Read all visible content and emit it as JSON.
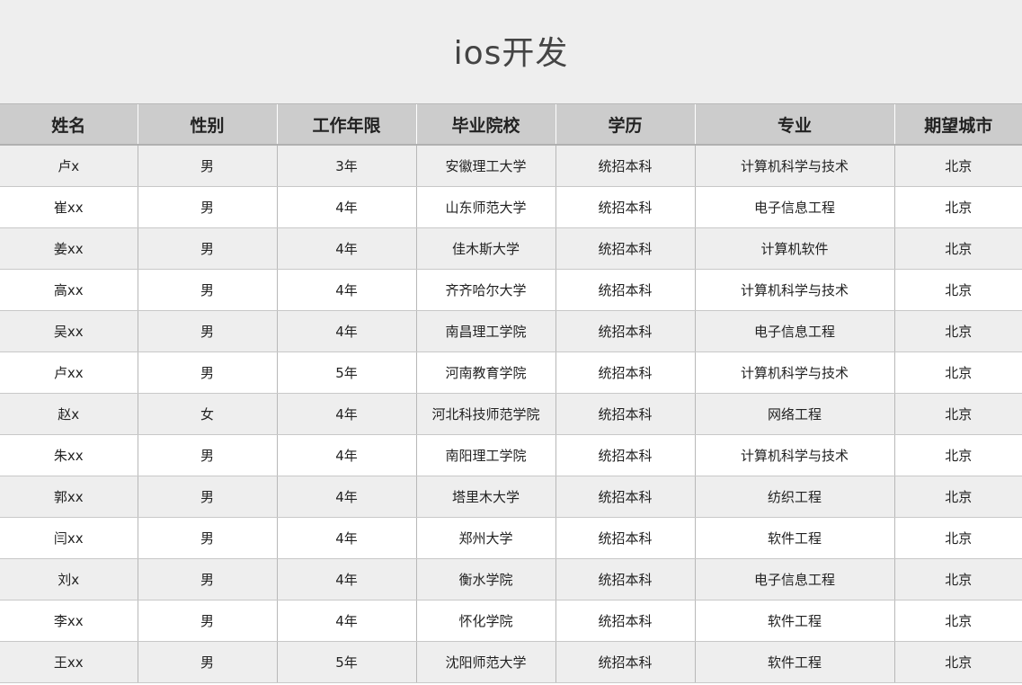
{
  "title": "ios开发",
  "columns": [
    "姓名",
    "性别",
    "工作年限",
    "毕业院校",
    "学历",
    "专业",
    "期望城市"
  ],
  "rows": [
    [
      "卢x",
      "男",
      "3年",
      "安徽理工大学",
      "统招本科",
      "计算机科学与技术",
      "北京"
    ],
    [
      "崔xx",
      "男",
      "4年",
      "山东师范大学",
      "统招本科",
      "电子信息工程",
      "北京"
    ],
    [
      "姜xx",
      "男",
      "4年",
      "佳木斯大学",
      "统招本科",
      "计算机软件",
      "北京"
    ],
    [
      "高xx",
      "男",
      "4年",
      "齐齐哈尔大学",
      "统招本科",
      "计算机科学与技术",
      "北京"
    ],
    [
      "吴xx",
      "男",
      "4年",
      "南昌理工学院",
      "统招本科",
      "电子信息工程",
      "北京"
    ],
    [
      "卢xx",
      "男",
      "5年",
      "河南教育学院",
      "统招本科",
      "计算机科学与技术",
      "北京"
    ],
    [
      "赵x",
      "女",
      "4年",
      "河北科技师范学院",
      "统招本科",
      "网络工程",
      "北京"
    ],
    [
      "朱xx",
      "男",
      "4年",
      "南阳理工学院",
      "统招本科",
      "计算机科学与技术",
      "北京"
    ],
    [
      "郭xx",
      "男",
      "4年",
      "塔里木大学",
      "统招本科",
      "纺织工程",
      "北京"
    ],
    [
      "闫xx",
      "男",
      "4年",
      "郑州大学",
      "统招本科",
      "软件工程",
      "北京"
    ],
    [
      "刘x",
      "男",
      "4年",
      "衡水学院",
      "统招本科",
      "电子信息工程",
      "北京"
    ],
    [
      "李xx",
      "男",
      "4年",
      "怀化学院",
      "统招本科",
      "软件工程",
      "北京"
    ],
    [
      "王xx",
      "男",
      "5年",
      "沈阳师范大学",
      "统招本科",
      "软件工程",
      "北京"
    ]
  ]
}
